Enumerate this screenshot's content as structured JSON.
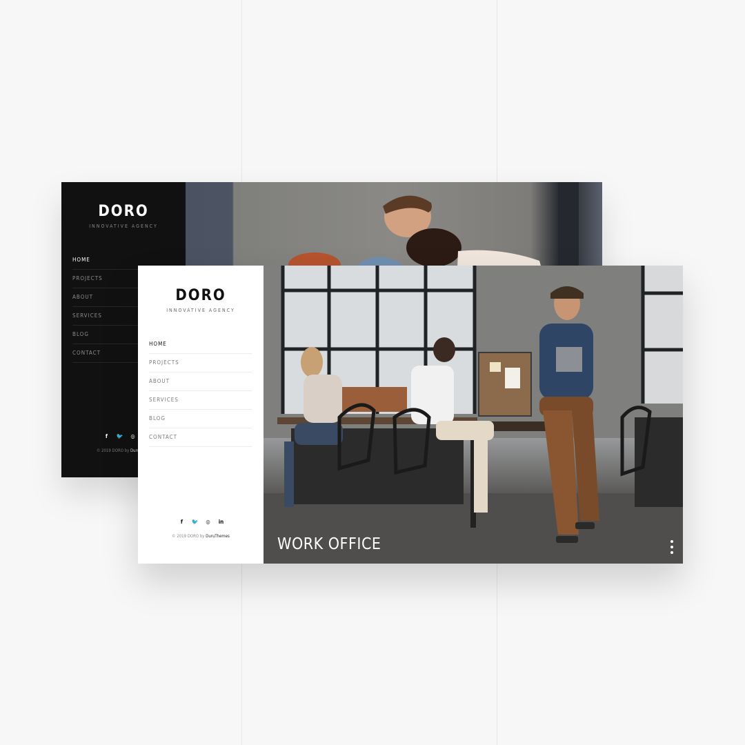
{
  "colors": {
    "page_bg": "#f7f7f7",
    "dark_sidebar_bg": "#111111",
    "light_sidebar_bg": "#ffffff",
    "hero_text": "#ffffff"
  },
  "dark_mockup": {
    "logo": "DORO",
    "tagline": "INNOVATIVE AGENCY",
    "nav": [
      "HOME",
      "PROJECTS",
      "ABOUT",
      "SERVICES",
      "BLOG",
      "CONTACT"
    ],
    "active_nav": "HOME",
    "social_icons": [
      "facebook-icon",
      "twitter-icon",
      "instagram-icon"
    ],
    "social_glyphs": [
      "f",
      "🐦",
      "◎"
    ],
    "copyright_text": "© 2019 DORO by ",
    "copyright_brand": "DuruT"
  },
  "light_mockup": {
    "logo": "DORO",
    "tagline": "INNOVATIVE AGENCY",
    "nav": [
      "HOME",
      "PROJECTS",
      "ABOUT",
      "SERVICES",
      "BLOG",
      "CONTACT"
    ],
    "active_nav": "HOME",
    "social_icons": [
      "facebook-icon",
      "twitter-icon",
      "instagram-icon",
      "linkedin-icon"
    ],
    "social_glyphs": [
      "f",
      "🐦",
      "◎",
      "in"
    ],
    "copyright_text": "© 2019 DORO by ",
    "copyright_brand": "DuruThemes",
    "hero_title": "WORK OFFICE",
    "slider_dots": 3
  }
}
